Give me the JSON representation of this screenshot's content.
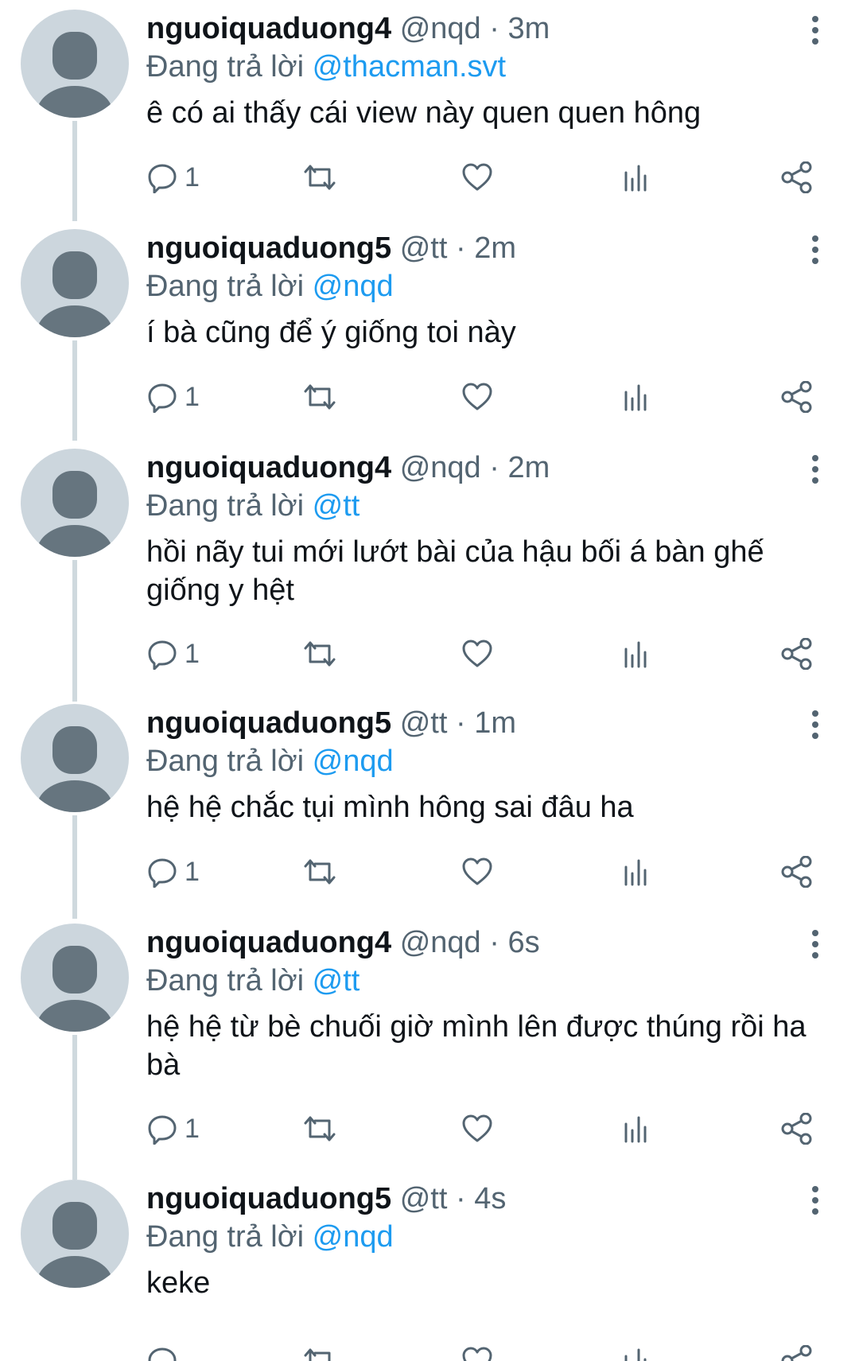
{
  "tweets": [
    {
      "username": "nguoiquaduong4",
      "handle": "@nqd",
      "separator": "·",
      "time": "3m",
      "replying_prefix": "Đang trả lời",
      "replying_to": "@thacman.svt",
      "text": "ê có ai thấy cái view này quen quen hông",
      "reply_count": "1"
    },
    {
      "username": "nguoiquaduong5",
      "handle": "@tt",
      "separator": "·",
      "time": "2m",
      "replying_prefix": "Đang trả lời",
      "replying_to": "@nqd",
      "text": "í bà cũng để ý giống toi này",
      "reply_count": "1"
    },
    {
      "username": "nguoiquaduong4",
      "handle": "@nqd",
      "separator": "·",
      "time": "2m",
      "replying_prefix": "Đang trả lời",
      "replying_to": "@tt",
      "text": "hồi nãy tui mới lướt bài của hậu bối á bàn ghế giống y hệt",
      "reply_count": "1"
    },
    {
      "username": "nguoiquaduong5",
      "handle": "@tt",
      "separator": "·",
      "time": "1m",
      "replying_prefix": "Đang trả lời",
      "replying_to": "@nqd",
      "text": "hệ hệ chắc tụi mình hông sai đâu ha",
      "reply_count": "1"
    },
    {
      "username": "nguoiquaduong4",
      "handle": "@nqd",
      "separator": "·",
      "time": "6s",
      "replying_prefix": "Đang trả lời",
      "replying_to": "@tt",
      "text": "hệ hệ từ bè chuối giờ mình lên được thúng rồi ha bà",
      "reply_count": "1"
    },
    {
      "username": "nguoiquaduong5",
      "handle": "@tt",
      "separator": "·",
      "time": "4s",
      "replying_prefix": "Đang trả lời",
      "replying_to": "@nqd",
      "text": "keke",
      "reply_count": ""
    }
  ],
  "icons": {
    "reply": "reply-icon",
    "retweet": "retweet-icon",
    "like": "heart-icon",
    "views": "views-icon",
    "share": "share-icon",
    "more": "more-icon",
    "avatar": "default-avatar"
  },
  "colors": {
    "text": "#0f1419",
    "secondary": "#536471",
    "mention": "#1d9bf0",
    "avatar_bg": "#ccd6dd",
    "avatar_fg": "#66757f",
    "thread_line": "#cfd9de"
  }
}
